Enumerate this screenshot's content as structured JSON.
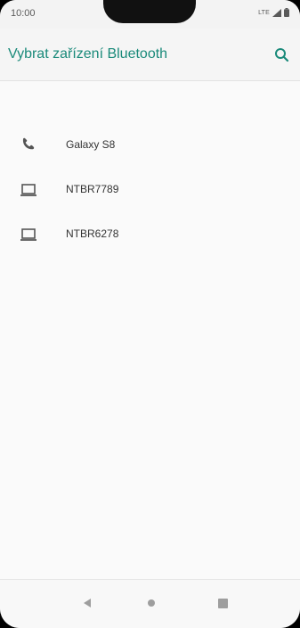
{
  "status_bar": {
    "time": "10:00",
    "network": "LTE",
    "icons": [
      "lte-signal-icon",
      "battery-icon"
    ]
  },
  "header": {
    "title": "Vybrat zařízení Bluetooth",
    "search_icon": "search-icon",
    "accent_color": "#1a8a7a"
  },
  "devices": [
    {
      "name": "Galaxy S8",
      "icon": "phone-icon"
    },
    {
      "name": "NTBR7789",
      "icon": "laptop-icon"
    },
    {
      "name": "NTBR6278",
      "icon": "laptop-icon"
    }
  ],
  "nav_bar": {
    "icons": [
      "back-icon",
      "home-icon",
      "recents-icon"
    ]
  }
}
